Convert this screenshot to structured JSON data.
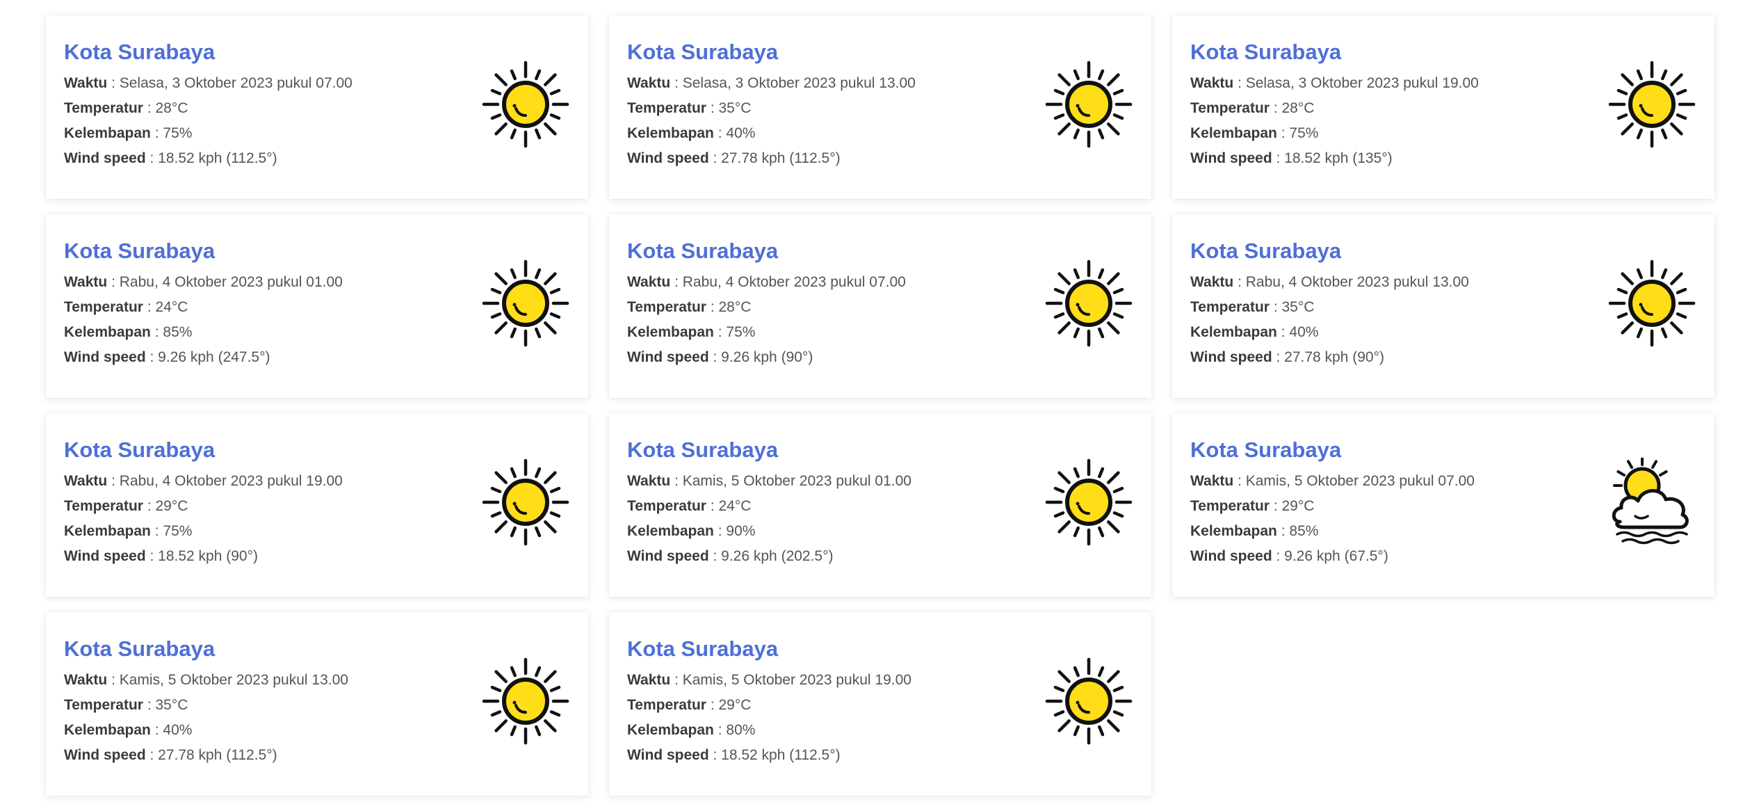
{
  "labels": {
    "time": "Waktu",
    "temperature": "Temperatur",
    "humidity": "Kelembapan",
    "wind": "Wind speed"
  },
  "cards": [
    {
      "city": "Kota Surabaya",
      "time": "Selasa, 3 Oktober 2023 pukul 07.00",
      "temperature": "28°C",
      "humidity": "75%",
      "wind": "18.52 kph (112.5°)",
      "icon": "sun-icon"
    },
    {
      "city": "Kota Surabaya",
      "time": "Selasa, 3 Oktober 2023 pukul 13.00",
      "temperature": "35°C",
      "humidity": "40%",
      "wind": "27.78 kph (112.5°)",
      "icon": "sun-icon"
    },
    {
      "city": "Kota Surabaya",
      "time": "Selasa, 3 Oktober 2023 pukul 19.00",
      "temperature": "28°C",
      "humidity": "75%",
      "wind": "18.52 kph (135°)",
      "icon": "sun-icon"
    },
    {
      "city": "Kota Surabaya",
      "time": "Rabu, 4 Oktober 2023 pukul 01.00",
      "temperature": "24°C",
      "humidity": "85%",
      "wind": "9.26 kph (247.5°)",
      "icon": "sun-icon"
    },
    {
      "city": "Kota Surabaya",
      "time": "Rabu, 4 Oktober 2023 pukul 07.00",
      "temperature": "28°C",
      "humidity": "75%",
      "wind": "9.26 kph (90°)",
      "icon": "sun-icon"
    },
    {
      "city": "Kota Surabaya",
      "time": "Rabu, 4 Oktober 2023 pukul 13.00",
      "temperature": "35°C",
      "humidity": "40%",
      "wind": "27.78 kph (90°)",
      "icon": "sun-icon"
    },
    {
      "city": "Kota Surabaya",
      "time": "Rabu, 4 Oktober 2023 pukul 19.00",
      "temperature": "29°C",
      "humidity": "75%",
      "wind": "18.52 kph (90°)",
      "icon": "sun-icon"
    },
    {
      "city": "Kota Surabaya",
      "time": "Kamis, 5 Oktober 2023 pukul 01.00",
      "temperature": "24°C",
      "humidity": "90%",
      "wind": "9.26 kph (202.5°)",
      "icon": "sun-icon"
    },
    {
      "city": "Kota Surabaya",
      "time": "Kamis, 5 Oktober 2023 pukul 07.00",
      "temperature": "29°C",
      "humidity": "85%",
      "wind": "9.26 kph (67.5°)",
      "icon": "cloudy-sun-icon"
    },
    {
      "city": "Kota Surabaya",
      "time": "Kamis, 5 Oktober 2023 pukul 13.00",
      "temperature": "35°C",
      "humidity": "40%",
      "wind": "27.78 kph (112.5°)",
      "icon": "sun-icon"
    },
    {
      "city": "Kota Surabaya",
      "time": "Kamis, 5 Oktober 2023 pukul 19.00",
      "temperature": "29°C",
      "humidity": "80%",
      "wind": "18.52 kph (112.5°)",
      "icon": "sun-icon"
    }
  ],
  "colors": {
    "accent": "#4e6fd6",
    "sun": "#ffde17",
    "outline": "#111111"
  }
}
